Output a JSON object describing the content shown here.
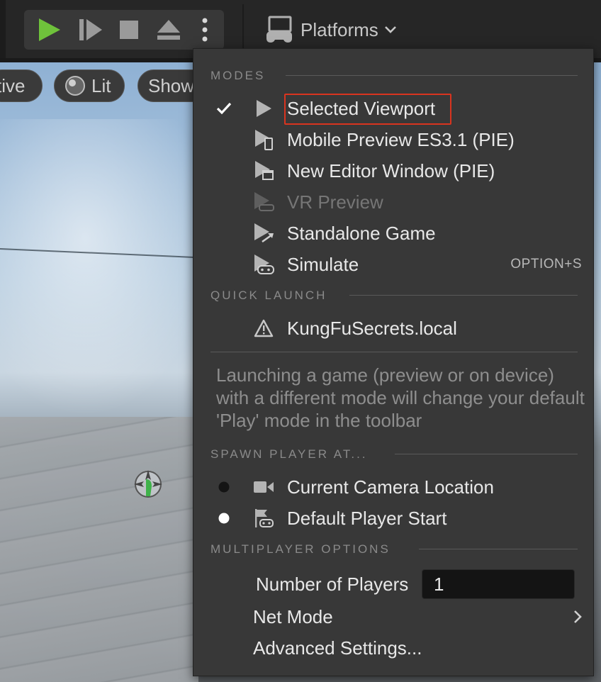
{
  "toolbar": {
    "buttons": [
      {
        "name": "play",
        "icon": "play-icon",
        "color": "#6fc23b"
      },
      {
        "name": "advance-frame",
        "icon": "advance-frame-icon"
      },
      {
        "name": "stop",
        "icon": "stop-icon"
      },
      {
        "name": "eject",
        "icon": "eject-icon"
      },
      {
        "name": "more-options",
        "icon": "vertical-dots-icon"
      }
    ],
    "platforms_label": "Platforms"
  },
  "viewport": {
    "pills": [
      "tive",
      "Lit",
      "Show"
    ]
  },
  "menu": {
    "sections": {
      "modes": "MODES",
      "quick_launch": "QUICK LAUNCH",
      "spawn": "SPAWN PLAYER AT...",
      "multiplayer": "MULTIPLAYER OPTIONS"
    },
    "modes": [
      {
        "label": "Selected Viewport",
        "icon": "play-icon",
        "checked": true,
        "highlighted": true
      },
      {
        "label": "Mobile Preview ES3.1 (PIE)",
        "icon": "mobile-preview-icon"
      },
      {
        "label": "New Editor Window (PIE)",
        "icon": "new-window-icon"
      },
      {
        "label": "VR Preview",
        "icon": "vr-preview-icon",
        "disabled": true
      },
      {
        "label": "Standalone Game",
        "icon": "standalone-icon"
      },
      {
        "label": "Simulate",
        "icon": "simulate-icon",
        "shortcut": "OPTION+S"
      }
    ],
    "quick_launch": [
      {
        "label": "KungFuSecrets.local",
        "icon": "warning-icon"
      }
    ],
    "info_text": "Launching a game (preview or on device) with a different mode will change your default 'Play' mode in the toolbar",
    "spawn": [
      {
        "label": "Current Camera Location",
        "icon": "camera-icon",
        "selected": false
      },
      {
        "label": "Default Player Start",
        "icon": "player-start-icon",
        "selected": true
      }
    ],
    "multiplayer": {
      "num_players_label": "Number of Players",
      "num_players_value": "1",
      "net_mode_label": "Net Mode",
      "advanced_label": "Advanced Settings..."
    }
  }
}
